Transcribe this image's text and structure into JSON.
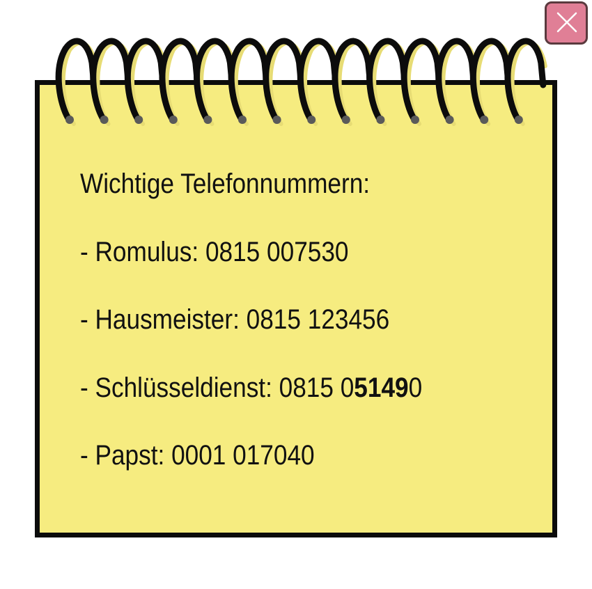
{
  "note": {
    "heading": "Wichtige Telefonnummern:",
    "entries": [
      {
        "label": "- Romulus: 0815 007530"
      },
      {
        "label": "- Hausmeister: 0815 123456"
      },
      {
        "prefix": "- Schlüsseldienst: 0815 0",
        "highlight": "5149",
        "suffix": "0"
      },
      {
        "label": "- Papst: 0001 017040"
      }
    ]
  },
  "colors": {
    "paper": "#f6ec80",
    "border": "#0c0c0c",
    "close_button": "#e07f96"
  },
  "icons": {
    "close": "close-icon",
    "binding": "spiral-binding"
  }
}
